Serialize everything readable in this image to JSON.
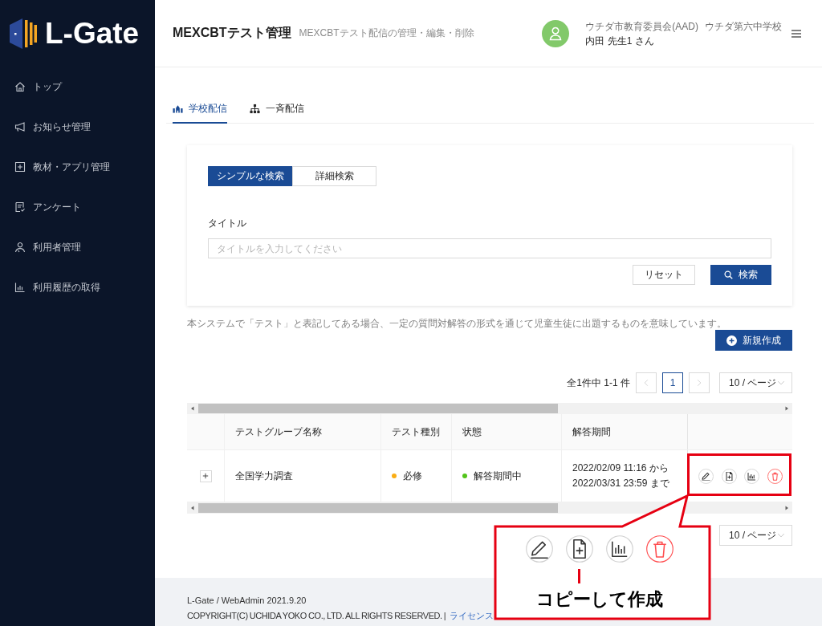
{
  "sidebar": {
    "logo": "L-Gate",
    "items": [
      {
        "label": "トップ",
        "selected": false
      },
      {
        "label": "お知らせ管理",
        "selected": false
      },
      {
        "label": "教材・アプリ管理",
        "selected": false
      },
      {
        "label": "アンケート",
        "selected": false
      },
      {
        "label": "利用者管理",
        "selected": false
      },
      {
        "label": "利用履歴の取得",
        "selected": false
      }
    ]
  },
  "header": {
    "title": "MEXCBTテスト管理",
    "subtitle": "MEXCBTテスト配信の管理・編集・削除",
    "user": {
      "organization": "ウチダ市教育委員会(AAD)",
      "school": "ウチダ第六中学校",
      "name": "内田 先生1 さん"
    }
  },
  "tabs": [
    {
      "label": "学校配信",
      "selected": true
    },
    {
      "label": "一斉配信",
      "selected": false
    }
  ],
  "search": {
    "modes": [
      {
        "label": "シンプルな検索",
        "selected": true
      },
      {
        "label": "詳細検索",
        "selected": false
      }
    ],
    "field_label": "タイトル",
    "placeholder": "タイトルを入力してください",
    "reset_button": "リセット",
    "search_button": "検索"
  },
  "notice": "本システムで「テスト」と表記してある場合、一定の質問対解答の形式を通じて児童生徒に出題するものを意味しています。",
  "create_button": "新規作成",
  "pagination_top": {
    "summary": "全1件中 1-1 件",
    "prev_disabled": true,
    "pages": [
      {
        "label": "1",
        "selected": true
      }
    ],
    "next_disabled": true,
    "page_size": "10 / ページ"
  },
  "table": {
    "columns": [
      "テストグループ名称",
      "テスト種別",
      "状態",
      "解答期間"
    ],
    "rows": [
      {
        "expanded": false,
        "name": "全国学力調査",
        "type": {
          "label": "必修",
          "color": "#faad14"
        },
        "status": {
          "label": "解答期間中",
          "color": "#52c41a"
        },
        "period": [
          "2022/02/09 11:16 から",
          "2022/03/31 23:59 まで"
        ]
      }
    ]
  },
  "pagination_bottom": {
    "page_size": "10 / ページ"
  },
  "annotation": {
    "caption": "コピーして作成"
  },
  "footer": {
    "version": "L-Gate / WebAdmin 2021.9.20",
    "copyright": "COPYRIGHT(C) UCHIDA YOKO CO., LTD. ALL RIGHTS RESERVED. |",
    "link": "ライセンス"
  }
}
